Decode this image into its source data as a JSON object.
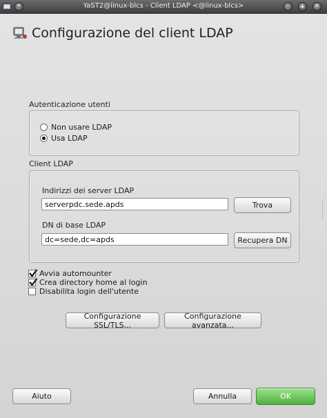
{
  "window": {
    "title": "YaST2@linux-blcs - Client LDAP <@linux-blcs>"
  },
  "header": {
    "title": "Configurazione del client LDAP"
  },
  "auth": {
    "group_label": "Autenticazione utenti",
    "options": [
      {
        "label": "Non usare LDAP",
        "selected": false
      },
      {
        "label": "Usa LDAP",
        "selected": true
      }
    ]
  },
  "client": {
    "group_label": "Client LDAP",
    "server_label": "Indirizzi dei server LDAP",
    "server_value": "serverpdc.sede.apds",
    "find_button": "Trova",
    "base_dn_label": "DN di base LDAP",
    "base_dn_value": "dc=sede,dc=apds",
    "fetch_dn_button": "Recupera DN"
  },
  "options": [
    {
      "label": "Avvia automounter",
      "checked": true
    },
    {
      "label": "Crea directory home al login",
      "checked": true
    },
    {
      "label": "Disabilita login dell'utente",
      "checked": false
    }
  ],
  "buttons": {
    "ssl_tls": "Configurazione SSL/TLS...",
    "advanced": "Configurazione avanzata...",
    "help": "Aiuto",
    "cancel": "Annulla",
    "ok": "OK"
  },
  "colors": {
    "ok_button": "#5cbf4a",
    "titlebar": "#4a4a4a"
  }
}
